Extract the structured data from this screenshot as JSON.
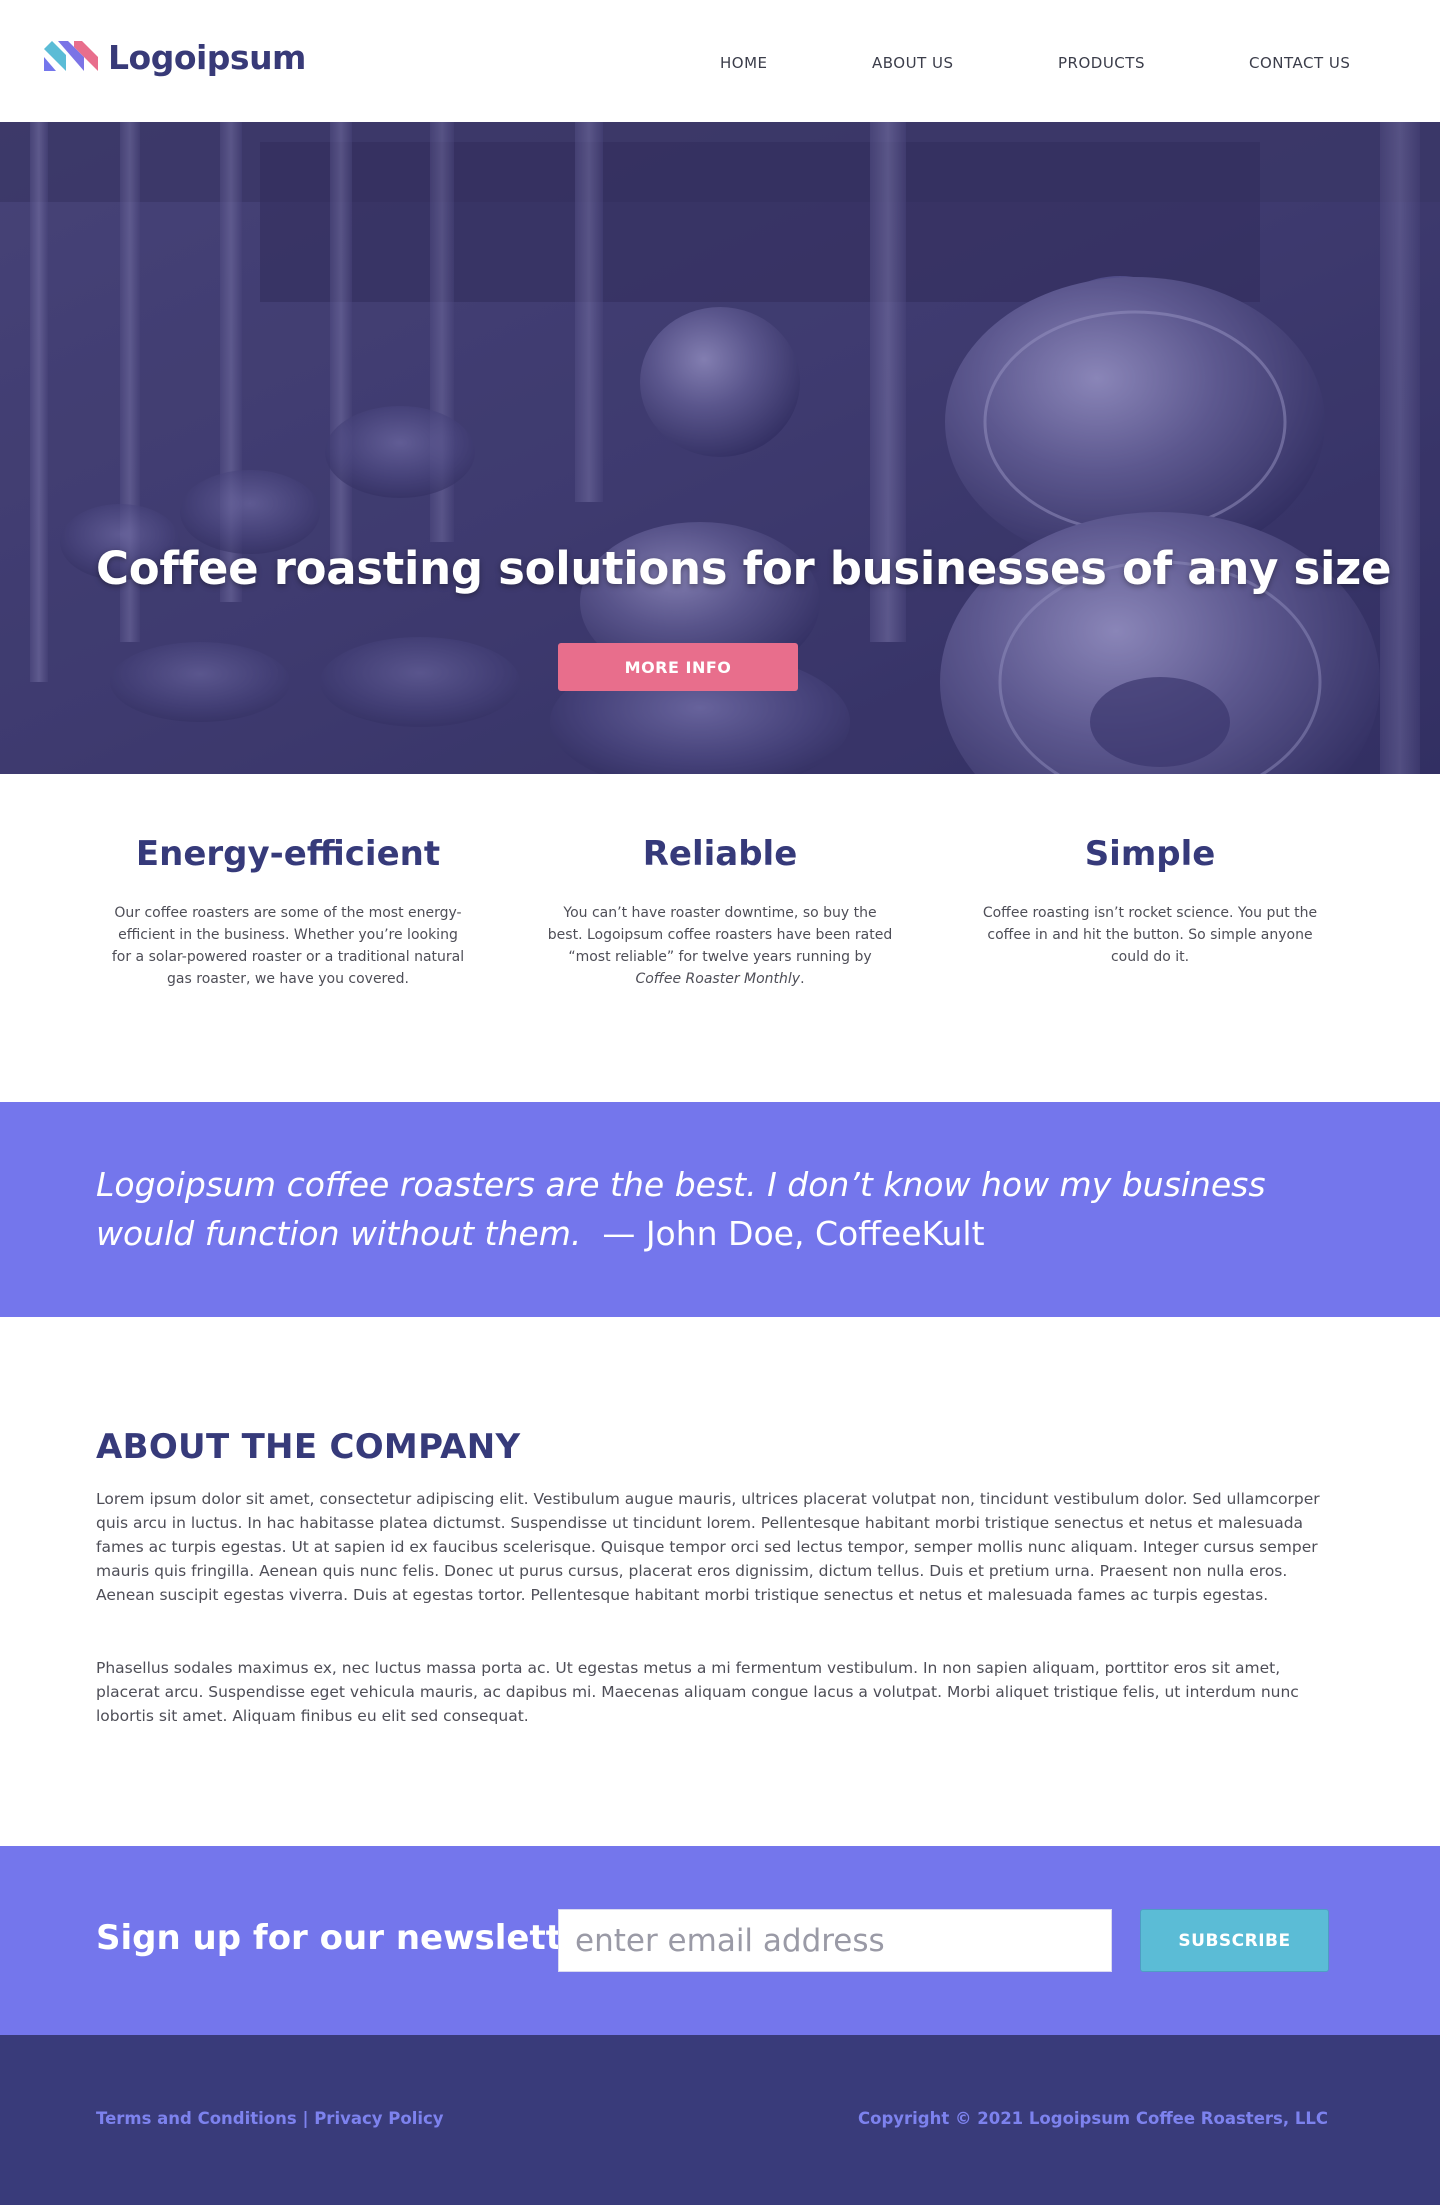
{
  "header": {
    "logo_text": "Logoipsum",
    "nav": [
      {
        "label": "HOME"
      },
      {
        "label": "ABOUT US"
      },
      {
        "label": "PRODUCTS"
      },
      {
        "label": "CONTACT US"
      }
    ]
  },
  "hero": {
    "title": "Coffee roasting solutions for businesses of any size",
    "button_label": "MORE INFO"
  },
  "features": [
    {
      "title": "Energy-efficient",
      "text": "Our coffee roasters are some of the most energy-efficient in the business. Whether you’re looking for a solar-powered roaster or a traditional natural gas roaster, we have you covered."
    },
    {
      "title": "Reliable",
      "text": "You can’t have roaster downtime, so buy the best. Logoipsum coffee roasters have been rated “most reliable” for twelve years running by",
      "text_italic": "Coffee Roaster Monthly",
      "text_end": "."
    },
    {
      "title": "Simple",
      "text": "Coffee roasting isn’t rocket science. You put the coffee in and hit the button. So simple anyone could do it."
    }
  ],
  "quote": {
    "text": "Logoipsum coffee roasters are the best. I don’t know how my business would function without them.",
    "attribution": "— John Doe, CoffeeKult"
  },
  "about": {
    "title": "ABOUT THE COMPANY",
    "paragraph1": "Lorem ipsum dolor sit amet, consectetur adipiscing elit. Vestibulum augue mauris, ultrices placerat volutpat non, tincidunt vestibulum dolor. Sed ullamcorper quis arcu in luctus. In hac habitasse platea dictumst. Suspendisse ut tincidunt lorem. Pellentesque habitant morbi tristique senectus et netus et malesuada fames ac turpis egestas. Ut at sapien id ex faucibus scelerisque. Quisque tempor orci sed lectus tempor, semper mollis nunc aliquam. Integer cursus semper mauris quis fringilla. Aenean quis nunc felis. Donec ut purus cursus, placerat eros dignissim, dictum tellus. Duis et pretium urna. Praesent non nulla eros. Aenean suscipit egestas viverra. Duis at egestas tortor. Pellentesque habitant morbi tristique senectus et netus et malesuada fames ac turpis egestas.",
    "paragraph2": "Phasellus sodales maximus ex, nec luctus massa porta ac. Ut egestas metus a mi fermentum vestibulum. In non sapien aliquam, porttitor eros sit amet, placerat arcu. Suspendisse eget vehicula mauris, ac dapibus mi. Maecenas aliquam congue lacus a volutpat. Morbi aliquet tristique felis, ut interdum nunc lobortis sit amet. Aliquam finibus eu elit sed consequat."
  },
  "newsletter": {
    "title": "Sign up for our newsletter",
    "placeholder": "enter email address",
    "button_label": "SUBSCRIBE"
  },
  "footer": {
    "terms": "Terms and Conditions",
    "separator": " | ",
    "privacy": "Privacy Policy",
    "copyright": "Copyright © 2021 Logoipsum Coffee Roasters, LLC"
  },
  "colors": {
    "brand_navy": "#383a78",
    "accent_purple": "#7476ec",
    "accent_pink": "#e86e8c",
    "accent_cyan": "#5bbcd6",
    "footer_bg": "#393b7a"
  }
}
